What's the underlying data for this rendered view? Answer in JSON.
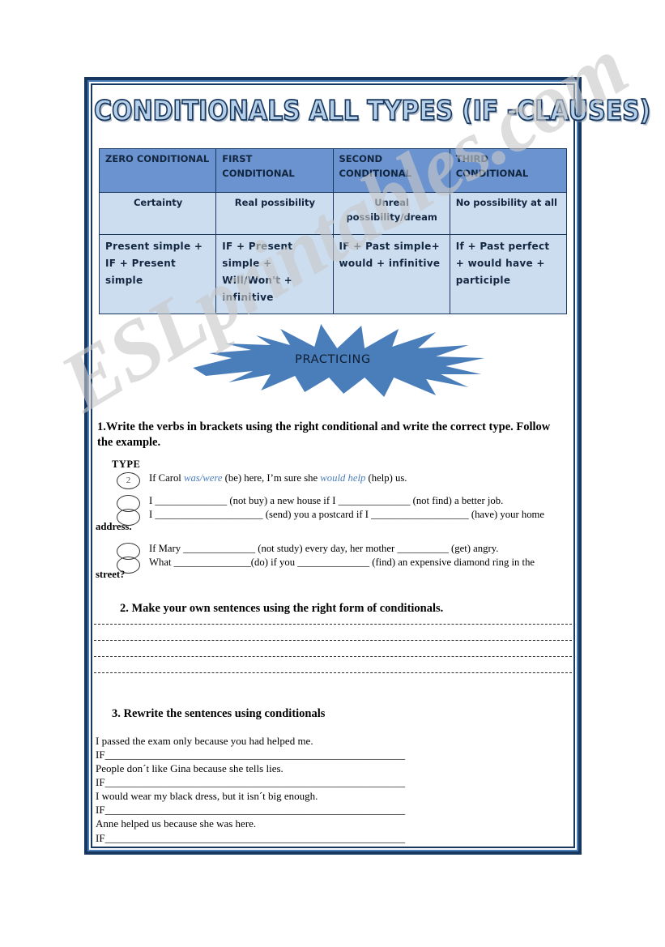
{
  "document": {
    "title": "CONDITIONALS ALL TYPES (IF -CLAUSES)",
    "watermark": "ESLprintables.com"
  },
  "colors": {
    "frame": "#17375e",
    "frame_accent": "#4a7ebb",
    "table_header_bg": "#6b93d0",
    "table_body_bg": "#ccddf0",
    "burst_fill": "#4a7ebb",
    "example_answer": "#4a7ebb",
    "watermark": "#c9c9c9"
  },
  "table": {
    "headers": [
      "ZERO CONDITIONAL",
      "FIRST CONDITIONAL",
      "SECOND CONDITIONAL",
      "THIRD CONDITIONAL"
    ],
    "meanings": [
      "Certainty",
      "Real possibility",
      "Unreal possibility/dream",
      "No possibility at  all"
    ],
    "formulas": [
      "Present simple + IF + Present simple",
      "IF + Present simple + Will/Won't + infinitive",
      "IF + Past simple+ would + infinitive",
      "If + Past perfect + would have + participle"
    ]
  },
  "burst": {
    "label": "PRACTICING"
  },
  "exercise1": {
    "heading": "1.Write the verbs in brackets using the right conditional and write the correct type. Follow the example.",
    "type_label": "TYPE",
    "items": [
      {
        "bubble": "2",
        "pre": "If Carol ",
        "answer1": "was/were",
        "mid": " (be) here, I’m sure she ",
        "answer2": "would help",
        "post": " (help) us."
      },
      {
        "bubble": "",
        "text": "I ______________ (not buy) a new house if I ______________ (not find) a better job."
      },
      {
        "bubble": "",
        "text": "I _____________________ (send) you a postcard if I ___________________ (have) your home",
        "continuation": "address."
      },
      {
        "bubble": "",
        "text": "If Mary ______________ (not study) every day, her mother __________ (get) angry."
      },
      {
        "bubble": "",
        "text": "What _______________(do) if you ______________ (find) an expensive  diamond ring in the",
        "continuation": "street?"
      }
    ]
  },
  "exercise2": {
    "heading": "2. Make your own sentences using the right form of conditionals.",
    "answer_lines": 4
  },
  "exercise3": {
    "heading": "3. Rewrite the sentences using conditionals",
    "if_prefix": "IF",
    "if_rule": "_________________________________________________________",
    "sentences": [
      "I passed the exam only because you had helped me.",
      "People don´t like Gina because she tells lies.",
      "I would wear my black dress, but it isn´t big enough.",
      "Anne helped us because she was here."
    ]
  }
}
